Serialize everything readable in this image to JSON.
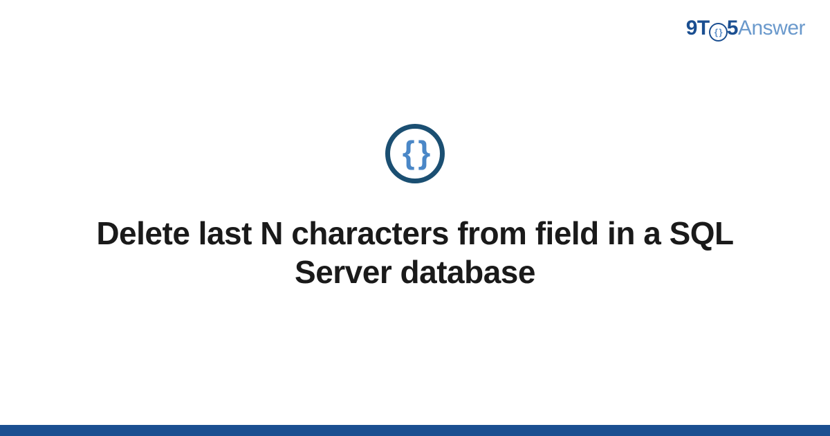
{
  "logo": {
    "part1": "9T",
    "o_inner": "{ }",
    "part2": "5",
    "part3": "Answer"
  },
  "badge": {
    "glyph": "{ }"
  },
  "title": "Delete last N characters from field in a SQL Server database"
}
